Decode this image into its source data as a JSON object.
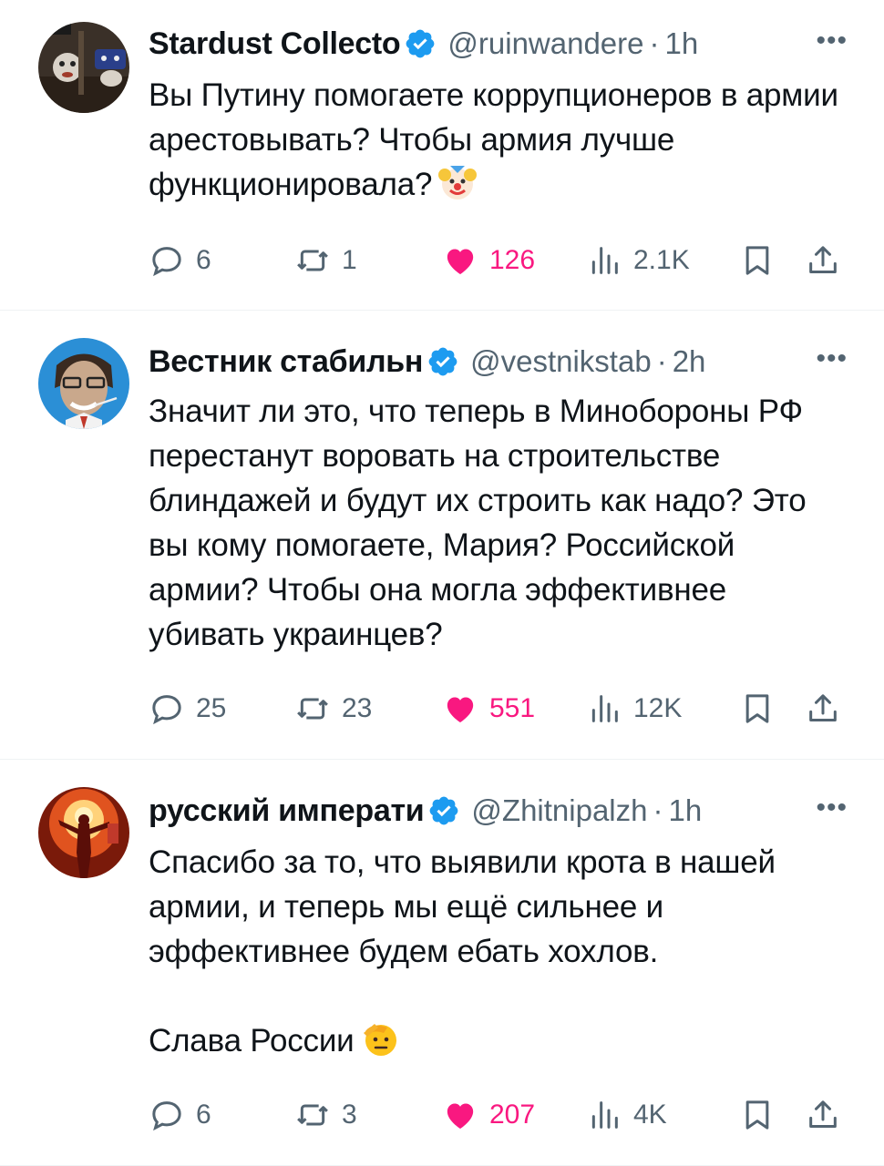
{
  "colors": {
    "text": "#0f1419",
    "muted": "#536471",
    "like_pink": "#f91880",
    "verified_blue": "#1d9bf0",
    "divider": "#eff3f4"
  },
  "icons": {
    "reply": "speech-bubble-icon",
    "repost": "repost-arrows-icon",
    "like": "heart-filled-icon",
    "views": "bar-chart-icon",
    "bookmark": "bookmark-icon",
    "share": "share-upload-icon",
    "verified": "verified-badge-icon",
    "more": "more-dots-icon"
  },
  "tweets": [
    {
      "name": "Stardust Collecto",
      "handle": "@ruinwandere",
      "separator": "·",
      "time": "1h",
      "more": "•••",
      "text_lines": [
        "Вы Путину помогаете коррупционеров в армии арестовывать? Чтобы армия лучше функционировала?"
      ],
      "emoji": "clown-face-emoji",
      "replies": "6",
      "reposts": "1",
      "likes": "126",
      "views": "2.1K"
    },
    {
      "name": "Вестник стабильн",
      "handle": "@vestnikstab",
      "separator": "·",
      "time": "2h",
      "more": "•••",
      "text_lines": [
        "Значит ли это, что теперь в Минобороны РФ перестанут воровать на строительстве блиндажей и будут их строить как надо? Это вы кому помогаете, Мария? Российской армии? Чтобы она могла эффективнее убивать украинцев?"
      ],
      "replies": "25",
      "reposts": "23",
      "likes": "551",
      "views": "12K"
    },
    {
      "name": "русский императи",
      "handle": "@Zhitnipalzh",
      "separator": "·",
      "time": "1h",
      "more": "•••",
      "text_lines": [
        "Спасибо за то, что выявили крота в нашей армии, и теперь мы ещё сильнее и эффективнее будем ебать хохлов.",
        "Слава России"
      ],
      "emoji": "saluting-face-emoji",
      "replies": "6",
      "reposts": "3",
      "likes": "207",
      "views": "4K"
    }
  ]
}
